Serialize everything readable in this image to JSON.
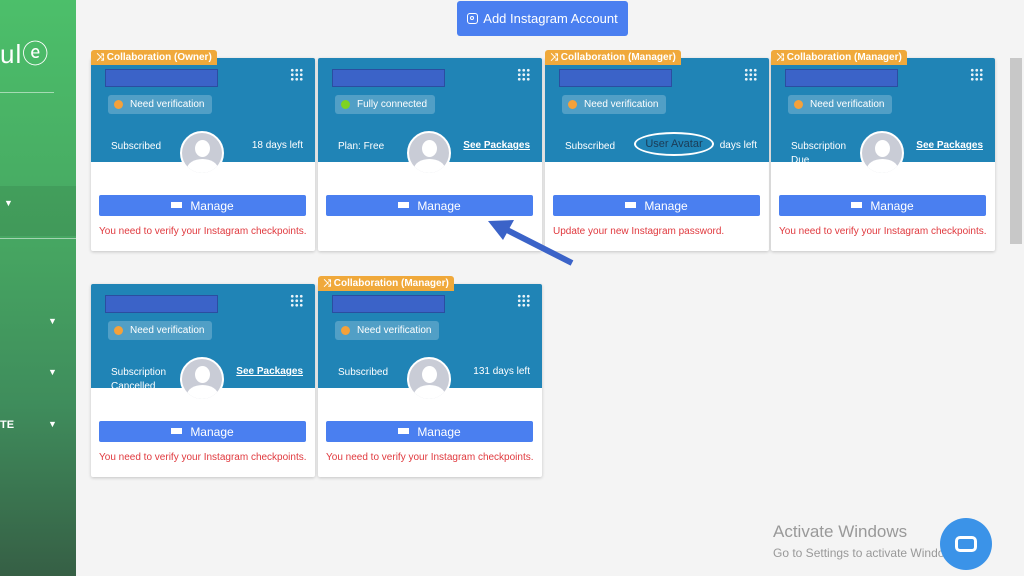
{
  "sidebar": {
    "logo": "ulⓔ",
    "item_partial": "TE"
  },
  "header": {
    "add_account_label": "Add Instagram Account",
    "add_icon": "instagram-icon"
  },
  "cards": [
    {
      "badge": "Collaboration (Owner)",
      "status": "Need verification",
      "status_color": "#f5a13a",
      "sub_left": "Subscribed",
      "sub_right": "18 days left",
      "sub_right_link": false,
      "avatar": "default",
      "manage": "Manage",
      "message": "You need to verify your Instagram checkpoints."
    },
    {
      "badge": "",
      "status": "Fully connected",
      "status_color": "#7ed321",
      "sub_left": "Plan: Free",
      "sub_right": "See Packages",
      "sub_right_link": true,
      "avatar": "default",
      "manage": "Manage",
      "message": ""
    },
    {
      "badge": "Collaboration (Manager)",
      "status": "Need verification",
      "status_color": "#f5a13a",
      "sub_left": "Subscribed",
      "sub_right": "days left",
      "sub_right_link": false,
      "avatar": "broken",
      "avatar_alt": "User Avatar",
      "manage": "Manage",
      "message": "Update your new Instagram password."
    },
    {
      "badge": "Collaboration (Manager)",
      "status": "Need verification",
      "status_color": "#f5a13a",
      "sub_left": "Subscription Due",
      "sub_right": "See Packages",
      "sub_right_link": true,
      "avatar": "default",
      "manage": "Manage",
      "message": "You need to verify your Instagram checkpoints."
    },
    {
      "badge": "",
      "status": "Need verification",
      "status_color": "#f5a13a",
      "sub_left": "Subscription Cancelled",
      "sub_right": "See Packages",
      "sub_right_link": true,
      "avatar": "default",
      "manage": "Manage",
      "message": "You need to verify your Instagram checkpoints."
    },
    {
      "badge": "Collaboration (Manager)",
      "status": "Need verification",
      "status_color": "#f5a13a",
      "sub_left": "Subscribed",
      "sub_right": "131 days left",
      "sub_right_link": false,
      "avatar": "default",
      "manage": "Manage",
      "message": "You need to verify your Instagram checkpoints."
    }
  ],
  "watermark": {
    "title": "Activate Windows",
    "subtitle": "Go to Settings to activate Windows."
  },
  "colors": {
    "card_header": "#2084b6",
    "badge": "#f0a93b",
    "button": "#4a7ff0",
    "error": "#e0393e",
    "arrow": "#3b63c8"
  }
}
